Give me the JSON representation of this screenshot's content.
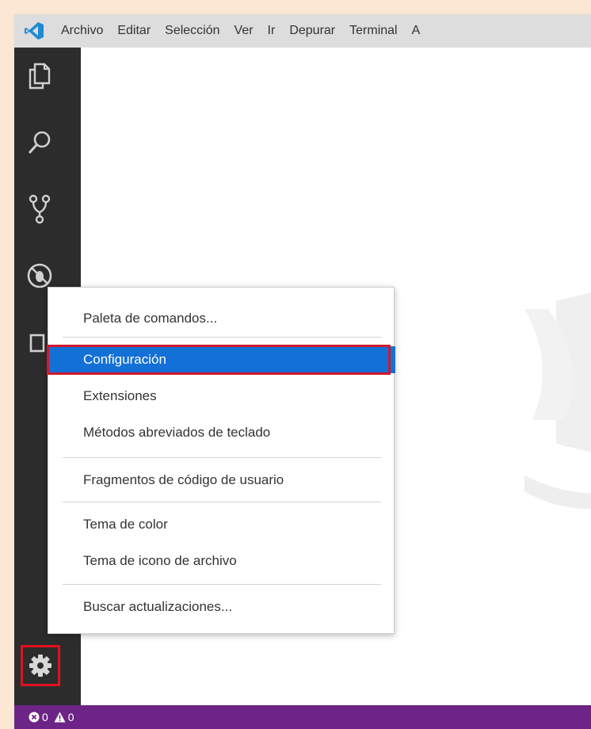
{
  "menubar": {
    "items": [
      "Archivo",
      "Editar",
      "Selección",
      "Ver",
      "Ir",
      "Depurar",
      "Terminal",
      "A"
    ]
  },
  "activity_bar": {
    "icons": [
      "explorer-icon",
      "search-icon",
      "source-control-icon",
      "debug-icon",
      "extensions-icon"
    ],
    "manage_icon": "gear-icon"
  },
  "context_menu": {
    "items": [
      "Paleta de comandos...",
      "Configuración",
      "Extensiones",
      "Métodos abreviados de teclado",
      "Fragmentos de código de usuario",
      "Tema de color",
      "Tema de icono de archivo",
      "Buscar actualizaciones..."
    ],
    "selected": "Configuración"
  },
  "status_bar": {
    "errors": "0",
    "warnings": "0"
  },
  "colors": {
    "page_background": "#fbe7d4",
    "menubar": "#dddddd",
    "activity_bar": "#2c2c2c",
    "selection": "#1370d6",
    "highlight_outline": "#e0101f",
    "status_bar": "#6c2486"
  }
}
